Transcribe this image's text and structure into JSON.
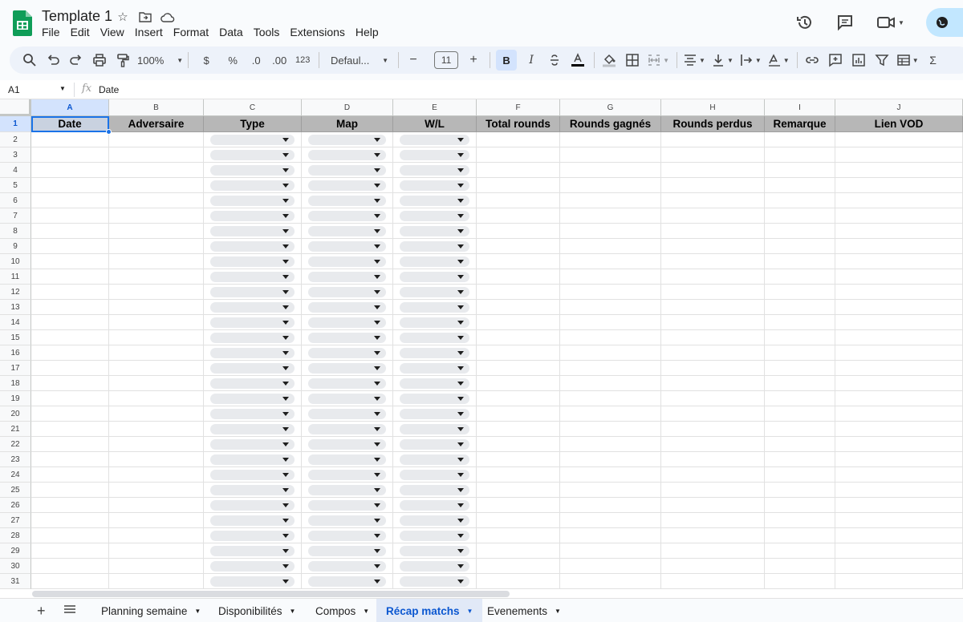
{
  "document": {
    "title": "Template 1"
  },
  "menu": [
    "File",
    "Edit",
    "View",
    "Insert",
    "Format",
    "Data",
    "Tools",
    "Extensions",
    "Help"
  ],
  "toolbar": {
    "zoom": "100%",
    "currency": "$",
    "percent": "%",
    "decrease_decimal": ".0",
    "increase_decimal": ".00",
    "number_format": "123",
    "font": "Defaul...",
    "font_size": "11",
    "bold": "B",
    "italic": "I"
  },
  "formula_bar": {
    "cell_ref": "A1",
    "fx": "fx",
    "content": "Date"
  },
  "sheet": {
    "columns": [
      "A",
      "B",
      "C",
      "D",
      "E",
      "F",
      "G",
      "H",
      "I",
      "J"
    ],
    "headers": [
      "Date",
      "Adversaire",
      "Type",
      "Map",
      "W/L",
      "Total rounds",
      "Rounds gagnés",
      "Rounds perdus",
      "Remarque",
      "Lien VOD"
    ],
    "rows": [
      "1",
      "2",
      "3",
      "4",
      "5",
      "6",
      "7",
      "8",
      "9",
      "10",
      "11",
      "12",
      "13",
      "14",
      "15",
      "16",
      "17",
      "18",
      "19",
      "20",
      "21",
      "22",
      "23",
      "24",
      "25",
      "26",
      "27",
      "28",
      "29",
      "30",
      "31"
    ],
    "dropdown_columns": [
      "C",
      "D",
      "E"
    ]
  },
  "tabs": [
    {
      "label": "Planning semaine",
      "active": false
    },
    {
      "label": "Disponibilités",
      "active": false
    },
    {
      "label": "Compos",
      "active": false
    },
    {
      "label": "Récap matchs",
      "active": true
    },
    {
      "label": "Evenements",
      "active": false
    }
  ],
  "colors": {
    "accent": "#1a73e8",
    "header_fill": "#b7b7b7",
    "sheets_green": "#0f9d58"
  }
}
